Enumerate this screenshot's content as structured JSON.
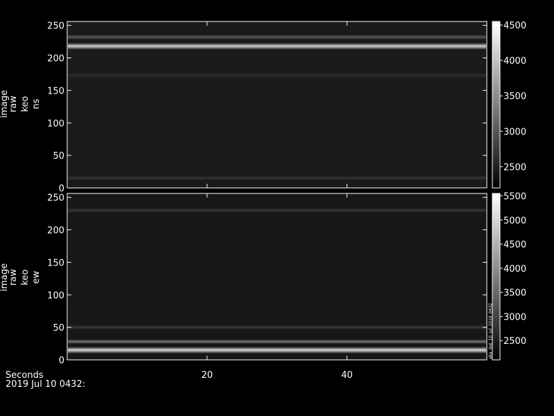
{
  "chart_data": [
    {
      "type": "heatmap",
      "ylabel_lines": [
        "image",
        "raw",
        "keo",
        "ns"
      ],
      "xlim": [
        0,
        60
      ],
      "ylim": [
        0,
        256
      ],
      "yticks": [
        0,
        50,
        100,
        150,
        200,
        250
      ],
      "colorbar": {
        "range": [
          2200,
          4550
        ],
        "ticks": [
          2500,
          3000,
          3500,
          4000,
          4500
        ]
      },
      "bright_bands": [
        {
          "row": 218,
          "intensity": 0.82
        },
        {
          "row": 232,
          "intensity": 0.35
        },
        {
          "row": 173,
          "intensity": 0.18
        },
        {
          "row": 15,
          "intensity": 0.2
        }
      ],
      "background_intensity": 0.1
    },
    {
      "type": "heatmap",
      "ylabel_lines": [
        "image",
        "raw",
        "keo",
        "ew"
      ],
      "xlim": [
        0,
        60
      ],
      "ylim": [
        0,
        256
      ],
      "yticks": [
        0,
        50,
        100,
        150,
        200,
        250
      ],
      "colorbar": {
        "range": [
          2100,
          5550
        ],
        "ticks": [
          2500,
          3000,
          3500,
          4000,
          4500,
          5000,
          5500
        ]
      },
      "colorbar_annotation": "aka_dat_10_Jul_2019_0432",
      "bright_bands": [
        {
          "row": 15,
          "intensity": 0.85
        },
        {
          "row": 28,
          "intensity": 0.45
        },
        {
          "row": 50,
          "intensity": 0.22
        },
        {
          "row": 230,
          "intensity": 0.22
        }
      ],
      "background_intensity": 0.09
    }
  ],
  "xaxis": {
    "label": "Seconds",
    "ticks": [
      20,
      40
    ]
  },
  "footer": "2019 Jul 10 0432:"
}
